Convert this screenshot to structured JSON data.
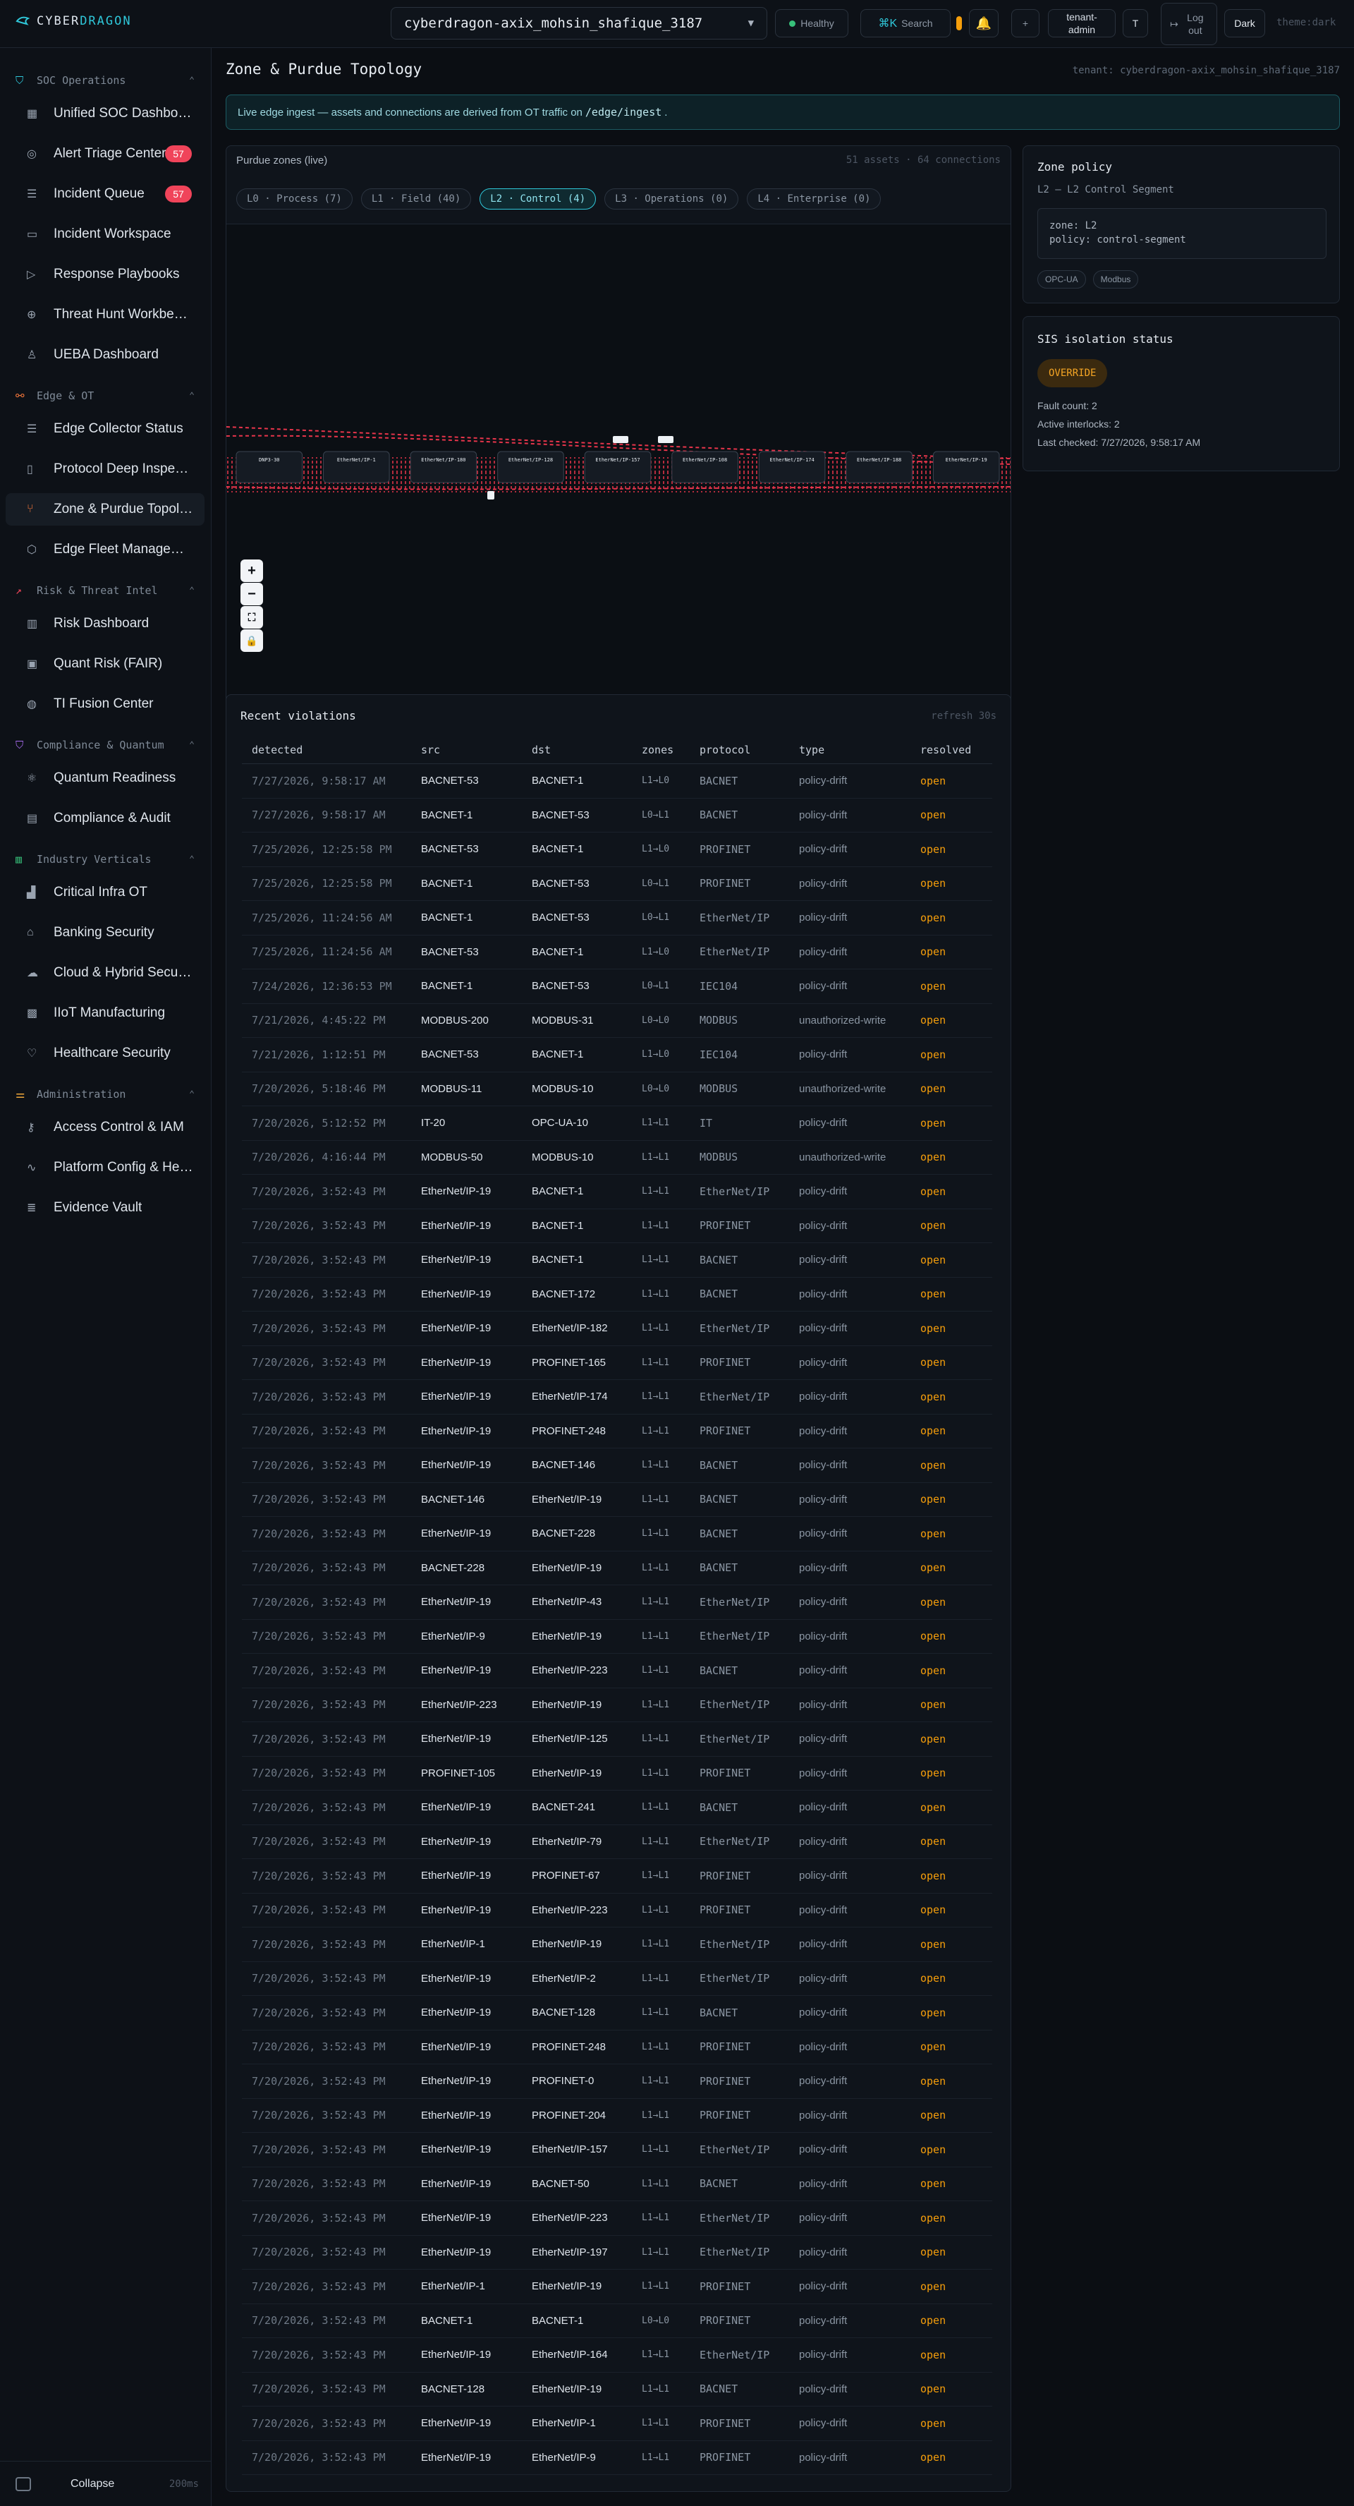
{
  "brand": {
    "prefix": "CYBER",
    "accent": "DRAGON"
  },
  "header": {
    "tenant": "cyberdragon-axix_mohsin_shafique_3187",
    "health": "Healthy",
    "search_key": "⌘K",
    "search_label": "Search",
    "user_label": "tenant-admin",
    "avatar": "T",
    "logout": "Log out",
    "theme_button": "Dark",
    "theme_label": "theme:dark",
    "plus": "+"
  },
  "sidebar": {
    "sections": [
      {
        "label": "SOC Operations",
        "icon": "shield-icon",
        "color": "#2fc7d9",
        "items": [
          {
            "label": "Unified SOC Dashboard",
            "icon": "grid-icon"
          },
          {
            "label": "Alert Triage Center",
            "icon": "radar-icon",
            "badge": "57"
          },
          {
            "label": "Incident Queue",
            "icon": "list-icon",
            "badge": "57"
          },
          {
            "label": "Incident Workspace",
            "icon": "folder-icon"
          },
          {
            "label": "Response Playbooks",
            "icon": "play-icon"
          },
          {
            "label": "Threat Hunt Workbench",
            "icon": "crosshair-icon"
          },
          {
            "label": "UEBA Dashboard",
            "icon": "user-icon"
          }
        ]
      },
      {
        "label": "Edge & OT",
        "icon": "network-icon",
        "color": "#f0753a",
        "items": [
          {
            "label": "Edge Collector Status",
            "icon": "server-icon"
          },
          {
            "label": "Protocol Deep Inspection",
            "icon": "file-icon"
          },
          {
            "label": "Zone & Purdue Topology",
            "icon": "branch-icon",
            "active": true
          },
          {
            "label": "Edge Fleet Management",
            "icon": "cube-icon"
          }
        ]
      },
      {
        "label": "Risk & Threat Intel",
        "icon": "trend-icon",
        "color": "#f0445a",
        "items": [
          {
            "label": "Risk Dashboard",
            "icon": "bar-chart-icon"
          },
          {
            "label": "Quant Risk (FAIR)",
            "icon": "calculator-icon"
          },
          {
            "label": "TI Fusion Center",
            "icon": "globe-icon"
          }
        ]
      },
      {
        "label": "Compliance & Quantum",
        "icon": "shield-check-icon",
        "color": "#a86cf0",
        "items": [
          {
            "label": "Quantum Readiness",
            "icon": "atom-icon"
          },
          {
            "label": "Compliance & Audit",
            "icon": "clipboard-icon"
          }
        ]
      },
      {
        "label": "Industry Verticals",
        "icon": "building-icon",
        "color": "#37c07a",
        "items": [
          {
            "label": "Critical Infra OT",
            "icon": "factory-icon"
          },
          {
            "label": "Banking Security",
            "icon": "bank-icon"
          },
          {
            "label": "Cloud & Hybrid Security",
            "icon": "cloud-icon"
          },
          {
            "label": "IIoT Manufacturing",
            "icon": "chip-icon"
          },
          {
            "label": "Healthcare Security",
            "icon": "heart-icon"
          }
        ]
      },
      {
        "label": "Administration",
        "icon": "sliders-icon",
        "color": "#f0a73a",
        "items": [
          {
            "label": "Access Control & IAM",
            "icon": "key-icon"
          },
          {
            "label": "Platform Config & Health",
            "icon": "pulse-icon"
          },
          {
            "label": "Evidence Vault",
            "icon": "database-icon"
          }
        ]
      }
    ],
    "collapse": "Collapse",
    "collapse_time": "200ms"
  },
  "page": {
    "title": "Zone & Purdue Topology",
    "tenant_tag": "tenant: cyberdragon-axix_mohsin_shafique_3187",
    "banner_prefix": "Live edge ingest — assets and connections are derived from OT traffic on",
    "banner_code": "/edge/ingest",
    "banner_suffix": "."
  },
  "topology": {
    "title": "Purdue zones (live)",
    "counts": "51 assets · 64 connections",
    "zones": [
      "L0 · Process (7)",
      "L1 · Field (40)",
      "L2 · Control (4)",
      "L3 · Operations (0)",
      "L4 · Enterprise (0)"
    ],
    "selected_zone": 2,
    "nodes": [
      "DNP3-30",
      "EtherNet/IP-1",
      "EtherNet/IP-180",
      "EtherNet/IP-128",
      "EtherNet/IP-157",
      "EtherNet/IP-108",
      "EtherNet/IP-174",
      "EtherNet/IP-188",
      "EtherNet/IP-19"
    ]
  },
  "zone_policy": {
    "title": "Zone policy",
    "subtitle": "L2 — L2 Control Segment",
    "zone_line": "zone: L2",
    "policy_line": "policy: control-segment",
    "protocols": [
      "OPC-UA",
      "Modbus"
    ]
  },
  "sis": {
    "title": "SIS isolation status",
    "state": "OVERRIDE",
    "fault_count": "Fault count: 2",
    "active_interlocks": "Active interlocks: 2",
    "last_checked_label": "Last checked:",
    "last_checked": "7/27/2026, 9:58:17 AM"
  },
  "violations": {
    "title": "Recent violations",
    "refresh": "refresh 30s",
    "columns": [
      "detected",
      "src",
      "dst",
      "zones",
      "protocol",
      "type",
      "resolved"
    ],
    "rows": [
      [
        "7/27/2026, 9:58:17 AM",
        "BACNET-53",
        "BACNET-1",
        "L1→L0",
        "BACNET",
        "policy-drift",
        "open"
      ],
      [
        "7/27/2026, 9:58:17 AM",
        "BACNET-1",
        "BACNET-53",
        "L0→L1",
        "BACNET",
        "policy-drift",
        "open"
      ],
      [
        "7/25/2026, 12:25:58 PM",
        "BACNET-53",
        "BACNET-1",
        "L1→L0",
        "PROFINET",
        "policy-drift",
        "open"
      ],
      [
        "7/25/2026, 12:25:58 PM",
        "BACNET-1",
        "BACNET-53",
        "L0→L1",
        "PROFINET",
        "policy-drift",
        "open"
      ],
      [
        "7/25/2026, 11:24:56 AM",
        "BACNET-1",
        "BACNET-53",
        "L0→L1",
        "EtherNet/IP",
        "policy-drift",
        "open"
      ],
      [
        "7/25/2026, 11:24:56 AM",
        "BACNET-53",
        "BACNET-1",
        "L1→L0",
        "EtherNet/IP",
        "policy-drift",
        "open"
      ],
      [
        "7/24/2026, 12:36:53 PM",
        "BACNET-1",
        "BACNET-53",
        "L0→L1",
        "IEC104",
        "policy-drift",
        "open"
      ],
      [
        "7/21/2026, 4:45:22 PM",
        "MODBUS-200",
        "MODBUS-31",
        "L0→L0",
        "MODBUS",
        "unauthorized-write",
        "open"
      ],
      [
        "7/21/2026, 1:12:51 PM",
        "BACNET-53",
        "BACNET-1",
        "L1→L0",
        "IEC104",
        "policy-drift",
        "open"
      ],
      [
        "7/20/2026, 5:18:46 PM",
        "MODBUS-11",
        "MODBUS-10",
        "L0→L0",
        "MODBUS",
        "unauthorized-write",
        "open"
      ],
      [
        "7/20/2026, 5:12:52 PM",
        "IT-20",
        "OPC-UA-10",
        "L1→L1",
        "IT",
        "policy-drift",
        "open"
      ],
      [
        "7/20/2026, 4:16:44 PM",
        "MODBUS-50",
        "MODBUS-10",
        "L1→L1",
        "MODBUS",
        "unauthorized-write",
        "open"
      ],
      [
        "7/20/2026, 3:52:43 PM",
        "EtherNet/IP-19",
        "BACNET-1",
        "L1→L1",
        "EtherNet/IP",
        "policy-drift",
        "open"
      ],
      [
        "7/20/2026, 3:52:43 PM",
        "EtherNet/IP-19",
        "BACNET-1",
        "L1→L1",
        "PROFINET",
        "policy-drift",
        "open"
      ],
      [
        "7/20/2026, 3:52:43 PM",
        "EtherNet/IP-19",
        "BACNET-1",
        "L1→L1",
        "BACNET",
        "policy-drift",
        "open"
      ],
      [
        "7/20/2026, 3:52:43 PM",
        "EtherNet/IP-19",
        "BACNET-172",
        "L1→L1",
        "BACNET",
        "policy-drift",
        "open"
      ],
      [
        "7/20/2026, 3:52:43 PM",
        "EtherNet/IP-19",
        "EtherNet/IP-182",
        "L1→L1",
        "EtherNet/IP",
        "policy-drift",
        "open"
      ],
      [
        "7/20/2026, 3:52:43 PM",
        "EtherNet/IP-19",
        "PROFINET-165",
        "L1→L1",
        "PROFINET",
        "policy-drift",
        "open"
      ],
      [
        "7/20/2026, 3:52:43 PM",
        "EtherNet/IP-19",
        "EtherNet/IP-174",
        "L1→L1",
        "EtherNet/IP",
        "policy-drift",
        "open"
      ],
      [
        "7/20/2026, 3:52:43 PM",
        "EtherNet/IP-19",
        "PROFINET-248",
        "L1→L1",
        "PROFINET",
        "policy-drift",
        "open"
      ],
      [
        "7/20/2026, 3:52:43 PM",
        "EtherNet/IP-19",
        "BACNET-146",
        "L1→L1",
        "BACNET",
        "policy-drift",
        "open"
      ],
      [
        "7/20/2026, 3:52:43 PM",
        "BACNET-146",
        "EtherNet/IP-19",
        "L1→L1",
        "BACNET",
        "policy-drift",
        "open"
      ],
      [
        "7/20/2026, 3:52:43 PM",
        "EtherNet/IP-19",
        "BACNET-228",
        "L1→L1",
        "BACNET",
        "policy-drift",
        "open"
      ],
      [
        "7/20/2026, 3:52:43 PM",
        "BACNET-228",
        "EtherNet/IP-19",
        "L1→L1",
        "BACNET",
        "policy-drift",
        "open"
      ],
      [
        "7/20/2026, 3:52:43 PM",
        "EtherNet/IP-19",
        "EtherNet/IP-43",
        "L1→L1",
        "EtherNet/IP",
        "policy-drift",
        "open"
      ],
      [
        "7/20/2026, 3:52:43 PM",
        "EtherNet/IP-9",
        "EtherNet/IP-19",
        "L1→L1",
        "EtherNet/IP",
        "policy-drift",
        "open"
      ],
      [
        "7/20/2026, 3:52:43 PM",
        "EtherNet/IP-19",
        "EtherNet/IP-223",
        "L1→L1",
        "BACNET",
        "policy-drift",
        "open"
      ],
      [
        "7/20/2026, 3:52:43 PM",
        "EtherNet/IP-223",
        "EtherNet/IP-19",
        "L1→L1",
        "EtherNet/IP",
        "policy-drift",
        "open"
      ],
      [
        "7/20/2026, 3:52:43 PM",
        "EtherNet/IP-19",
        "EtherNet/IP-125",
        "L1→L1",
        "EtherNet/IP",
        "policy-drift",
        "open"
      ],
      [
        "7/20/2026, 3:52:43 PM",
        "PROFINET-105",
        "EtherNet/IP-19",
        "L1→L1",
        "PROFINET",
        "policy-drift",
        "open"
      ],
      [
        "7/20/2026, 3:52:43 PM",
        "EtherNet/IP-19",
        "BACNET-241",
        "L1→L1",
        "BACNET",
        "policy-drift",
        "open"
      ],
      [
        "7/20/2026, 3:52:43 PM",
        "EtherNet/IP-19",
        "EtherNet/IP-79",
        "L1→L1",
        "EtherNet/IP",
        "policy-drift",
        "open"
      ],
      [
        "7/20/2026, 3:52:43 PM",
        "EtherNet/IP-19",
        "PROFINET-67",
        "L1→L1",
        "PROFINET",
        "policy-drift",
        "open"
      ],
      [
        "7/20/2026, 3:52:43 PM",
        "EtherNet/IP-19",
        "EtherNet/IP-223",
        "L1→L1",
        "PROFINET",
        "policy-drift",
        "open"
      ],
      [
        "7/20/2026, 3:52:43 PM",
        "EtherNet/IP-1",
        "EtherNet/IP-19",
        "L1→L1",
        "EtherNet/IP",
        "policy-drift",
        "open"
      ],
      [
        "7/20/2026, 3:52:43 PM",
        "EtherNet/IP-19",
        "EtherNet/IP-2",
        "L1→L1",
        "EtherNet/IP",
        "policy-drift",
        "open"
      ],
      [
        "7/20/2026, 3:52:43 PM",
        "EtherNet/IP-19",
        "BACNET-128",
        "L1→L1",
        "BACNET",
        "policy-drift",
        "open"
      ],
      [
        "7/20/2026, 3:52:43 PM",
        "EtherNet/IP-19",
        "PROFINET-248",
        "L1→L1",
        "PROFINET",
        "policy-drift",
        "open"
      ],
      [
        "7/20/2026, 3:52:43 PM",
        "EtherNet/IP-19",
        "PROFINET-0",
        "L1→L1",
        "PROFINET",
        "policy-drift",
        "open"
      ],
      [
        "7/20/2026, 3:52:43 PM",
        "EtherNet/IP-19",
        "PROFINET-204",
        "L1→L1",
        "PROFINET",
        "policy-drift",
        "open"
      ],
      [
        "7/20/2026, 3:52:43 PM",
        "EtherNet/IP-19",
        "EtherNet/IP-157",
        "L1→L1",
        "EtherNet/IP",
        "policy-drift",
        "open"
      ],
      [
        "7/20/2026, 3:52:43 PM",
        "EtherNet/IP-19",
        "BACNET-50",
        "L1→L1",
        "BACNET",
        "policy-drift",
        "open"
      ],
      [
        "7/20/2026, 3:52:43 PM",
        "EtherNet/IP-19",
        "EtherNet/IP-223",
        "L1→L1",
        "EtherNet/IP",
        "policy-drift",
        "open"
      ],
      [
        "7/20/2026, 3:52:43 PM",
        "EtherNet/IP-19",
        "EtherNet/IP-197",
        "L1→L1",
        "EtherNet/IP",
        "policy-drift",
        "open"
      ],
      [
        "7/20/2026, 3:52:43 PM",
        "EtherNet/IP-1",
        "EtherNet/IP-19",
        "L1→L1",
        "PROFINET",
        "policy-drift",
        "open"
      ],
      [
        "7/20/2026, 3:52:43 PM",
        "BACNET-1",
        "BACNET-1",
        "L0→L0",
        "PROFINET",
        "policy-drift",
        "open"
      ],
      [
        "7/20/2026, 3:52:43 PM",
        "EtherNet/IP-19",
        "EtherNet/IP-164",
        "L1→L1",
        "EtherNet/IP",
        "policy-drift",
        "open"
      ],
      [
        "7/20/2026, 3:52:43 PM",
        "BACNET-128",
        "EtherNet/IP-19",
        "L1→L1",
        "BACNET",
        "policy-drift",
        "open"
      ],
      [
        "7/20/2026, 3:52:43 PM",
        "EtherNet/IP-19",
        "EtherNet/IP-1",
        "L1→L1",
        "PROFINET",
        "policy-drift",
        "open"
      ],
      [
        "7/20/2026, 3:52:43 PM",
        "EtherNet/IP-19",
        "EtherNet/IP-9",
        "L1→L1",
        "PROFINET",
        "policy-drift",
        "open"
      ]
    ]
  }
}
